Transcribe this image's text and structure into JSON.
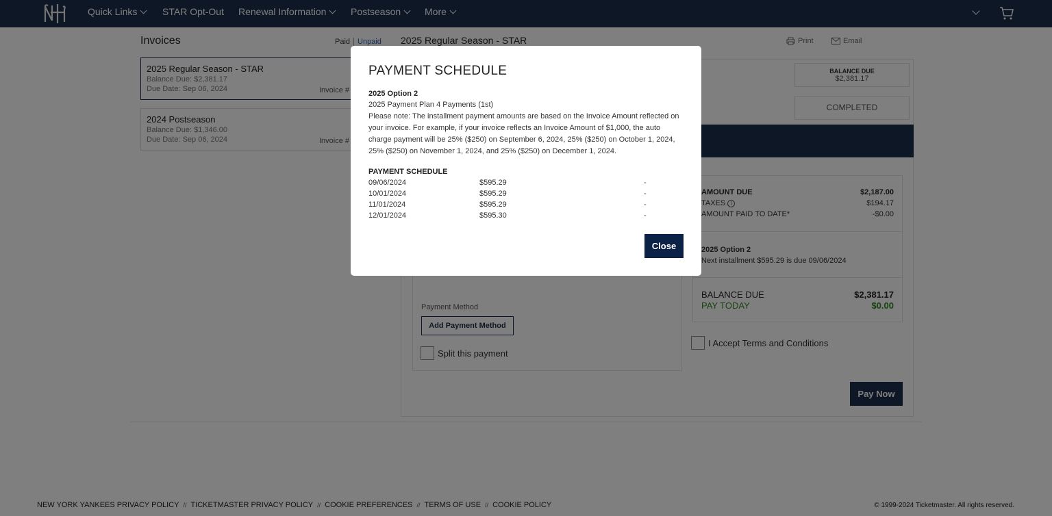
{
  "nav": {
    "logo": "ny-logo",
    "items": [
      {
        "label": "Quick Links",
        "has_dropdown": true
      },
      {
        "label": "STAR Opt-Out",
        "has_dropdown": false
      },
      {
        "label": "Renewal Information",
        "has_dropdown": true
      },
      {
        "label": "Postseason",
        "has_dropdown": true
      },
      {
        "label": "More",
        "has_dropdown": true
      }
    ],
    "cart_icon": "cart-icon"
  },
  "invoices": {
    "title": "Invoices",
    "tab_paid": "Paid",
    "tab_unpaid": "Unpaid",
    "cards": [
      {
        "title": "2025 Regular Season - STAR",
        "balance": "Balance Due: $2,381.17",
        "due": "Due Date: Sep 06, 2024",
        "invoice": "Invoice #"
      },
      {
        "title": "2024 Postseason",
        "balance": "Balance Due: $1,346.00",
        "due": "Due Date: Sep 06, 2024",
        "invoice": "Invoice #"
      }
    ]
  },
  "main": {
    "heading": "2025 Regular Season - STAR",
    "print_label": "Print",
    "email_label": "Email",
    "balance_due_label": "BALANCE DUE",
    "balance_due_value": "$2,381.17",
    "status": "COMPLETED",
    "payment_method_label": "Payment Method",
    "add_payment_method": "Add Payment Method",
    "split_payment": "Split this payment",
    "summary": {
      "amount_due_label": "AMOUNT DUE",
      "amount_due_value": "$2,187.00",
      "taxes_label": "TAXES",
      "taxes_value": "$194.17",
      "paid_label": "AMOUNT PAID TO DATE*",
      "paid_value": "-$0.00",
      "option_title": "2025 Option 2",
      "next_installment": "Next installment $595.29 is due 09/06/2024",
      "balance_label": "BALANCE DUE",
      "balance_value": "$2,381.17",
      "pay_today_label": "PAY TODAY",
      "pay_today_value": "$0.00"
    },
    "terms": "I Accept Terms and Conditions",
    "pay_now": "Pay Now"
  },
  "footer": {
    "links": [
      "NEW YORK YANKEES PRIVACY POLICY",
      "TICKETMASTER PRIVACY POLICY",
      "COOKIE PREFERENCES",
      "TERMS OF USE",
      "COOKIE POLICY"
    ],
    "separator": "//",
    "copyright": "© 1999-2024 Ticketmaster. All rights reserved."
  },
  "modal": {
    "title": "PAYMENT SCHEDULE",
    "option": "2025 Option 2",
    "plan": "2025 Payment Plan 4 Payments (1st)",
    "note": "Please note: The installment payment amounts are based on the Invoice Amount reflected on your invoice. For example, if your invoice reflects an Invoice Amount of $1,000, the auto charge payment will be 25% ($250) on September 6, 2024, 25% ($250) on October 1, 2024, 25% ($250) on November 1, 2024, and 25% ($250) on December 1, 2024.",
    "schedule_title": "PAYMENT SCHEDULE",
    "schedule": [
      {
        "date": "09/06/2024",
        "amount": "$595.29",
        "status": "-"
      },
      {
        "date": "10/01/2024",
        "amount": "$595.29",
        "status": "-"
      },
      {
        "date": "11/01/2024",
        "amount": "$595.29",
        "status": "-"
      },
      {
        "date": "12/01/2024",
        "amount": "$595.30",
        "status": "-"
      }
    ],
    "close": "Close"
  },
  "colors": {
    "navy": "#1c2e4a",
    "close_button": "#0b2146",
    "green": "#2e8b1f",
    "link_blue": "#2f5da8"
  }
}
